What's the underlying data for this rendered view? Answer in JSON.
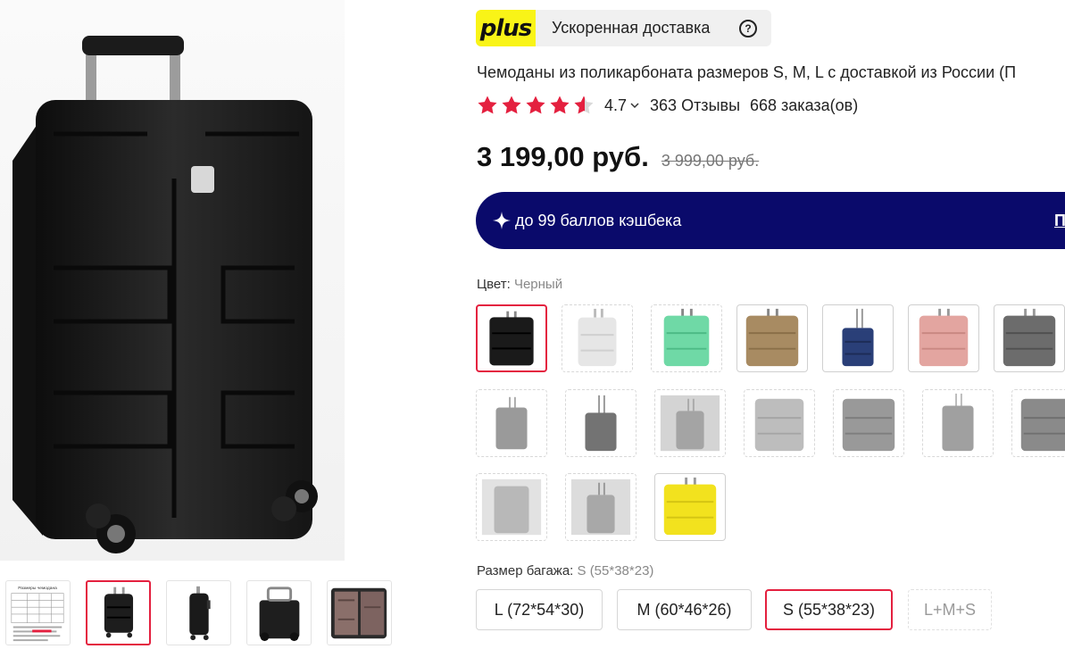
{
  "delivery": {
    "logo_text": "plus",
    "label": "Ускоренная доставка",
    "help_icon": "question-circle-icon",
    "help_glyph": "?"
  },
  "product": {
    "title": "Чемоданы из поликарбоната размеров S, M, L с доставкой из России (П",
    "rating_value": "4.7",
    "rating_stars": 4.7,
    "reviews": "363 Отзывы",
    "orders": "668 заказа(ов)",
    "price": "3 199,00 руб.",
    "old_price": "3 999,00 руб."
  },
  "cashback": {
    "text": "до 99 баллов кэшбека",
    "link_text": "П"
  },
  "color": {
    "label": "Цвет:",
    "value": "Черный",
    "swatches": [
      {
        "name": "black",
        "color": "#1a1a1a"
      },
      {
        "name": "white",
        "color": "#e6e6e6"
      },
      {
        "name": "mint",
        "color": "#6fd9a6"
      },
      {
        "name": "bronze",
        "color": "#a88b62"
      },
      {
        "name": "navy",
        "color": "#2a3f78"
      },
      {
        "name": "pink",
        "color": "#e3a5a0"
      },
      {
        "name": "gray",
        "color": "#6c6c6c"
      },
      {
        "name": "gray-1",
        "color": "#9a9a9a"
      },
      {
        "name": "gray-2",
        "color": "#737373"
      },
      {
        "name": "gray-3",
        "color": "#a4a4a4"
      },
      {
        "name": "gray-4",
        "color": "#bdbdbd"
      },
      {
        "name": "gray-5",
        "color": "#999999"
      },
      {
        "name": "gray-6",
        "color": "#a0a0a0"
      },
      {
        "name": "gray-7",
        "color": "#8a8a8a"
      },
      {
        "name": "gray-8",
        "color": "#b8b8b8"
      },
      {
        "name": "gray-9",
        "color": "#a8a8a8"
      },
      {
        "name": "yellow",
        "color": "#f2e21e"
      }
    ]
  },
  "size": {
    "label": "Размер багажа:",
    "value": "S (55*38*23)",
    "options": [
      "L (72*54*30)",
      "M (60*46*26)",
      "S (55*38*23)",
      "L+M+S"
    ]
  },
  "thumbnails": [
    "size-chart",
    "front-black",
    "side-black",
    "back-black",
    "open-black"
  ],
  "thumb_chart_text": "Размеры чемодана",
  "colors": {
    "accent": "#e4203f",
    "plus_yellow": "#f9f417",
    "cashback_bg": "#0a0a6b",
    "star": "#e4203f"
  }
}
